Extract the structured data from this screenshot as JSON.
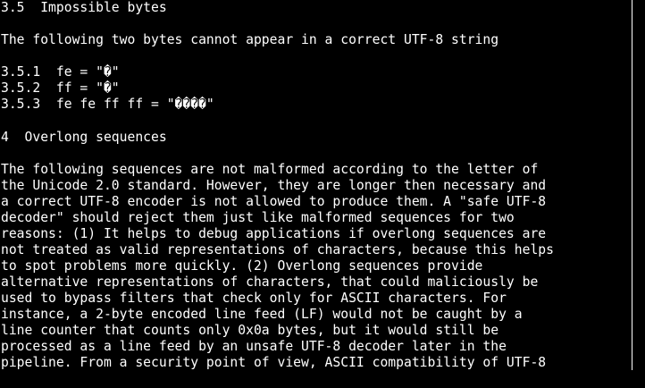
{
  "terminal": {
    "lines": [
      "3.5  Impossible bytes",
      "",
      "The following two bytes cannot appear in a correct UTF-8 string",
      "",
      "3.5.1  fe = \"�\"",
      "3.5.2  ff = \"�\"",
      "3.5.3  fe fe ff ff = \"����\"",
      "",
      "4  Overlong sequences",
      "",
      "The following sequences are not malformed according to the letter of",
      "the Unicode 2.0 standard. However, they are longer then necessary and",
      "a correct UTF-8 encoder is not allowed to produce them. A \"safe UTF-8",
      "decoder\" should reject them just like malformed sequences for two",
      "reasons: (1) It helps to debug applications if overlong sequences are",
      "not treated as valid representations of characters, because this helps",
      "to spot problems more quickly. (2) Overlong sequences provide",
      "alternative representations of characters, that could maliciously be",
      "used to bypass filters that check only for ASCII characters. For",
      "instance, a 2-byte encoded line feed (LF) would not be caught by a",
      "line counter that counts only 0x0a bytes, but it would still be",
      "processed as a line feed by an unsafe UTF-8 decoder later in the",
      "pipeline. From a security point of view, ASCII compatibility of UTF-8"
    ]
  },
  "colors": {
    "background": "#000000",
    "foreground": "#ffffff"
  }
}
